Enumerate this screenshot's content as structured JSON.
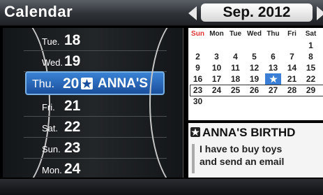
{
  "header": {
    "title": "Calendar",
    "month_label": "Sep. 2012"
  },
  "day_list": [
    {
      "dow": "Tue.",
      "num": "18"
    },
    {
      "dow": "Wed.",
      "num": "19"
    },
    {
      "dow": "Thu.",
      "num": "20",
      "event": "ANNA'S"
    },
    {
      "dow": "Fri.",
      "num": "21"
    },
    {
      "dow": "Sat.",
      "num": "22"
    },
    {
      "dow": "Sun.",
      "num": "23"
    },
    {
      "dow": "Mon.",
      "num": "24"
    }
  ],
  "month_grid": {
    "weekdays": [
      "Sun",
      "Mon",
      "Tue",
      "Wed",
      "Thu",
      "Fri",
      "Sat"
    ],
    "weeks": [
      [
        "",
        "",
        "",
        "",
        "",
        "",
        "1"
      ],
      [
        "2",
        "3",
        "4",
        "5",
        "6",
        "7",
        "8"
      ],
      [
        "9",
        "10",
        "11",
        "12",
        "13",
        "14",
        "15"
      ],
      [
        "16",
        "17",
        "18",
        "19",
        "",
        "21",
        "22"
      ],
      [
        "23",
        "24",
        "25",
        "26",
        "27",
        "28",
        "29"
      ],
      [
        "30",
        "",
        "",
        "",
        "",
        "",
        ""
      ]
    ]
  },
  "event_detail": {
    "title": "ANNA'S BIRTHD",
    "note": "I have to buy toys\nand send an email"
  },
  "colors": {
    "selection": "#2a6fc0",
    "sunday": "#d33333",
    "accent_today": "#3a7fd5"
  }
}
